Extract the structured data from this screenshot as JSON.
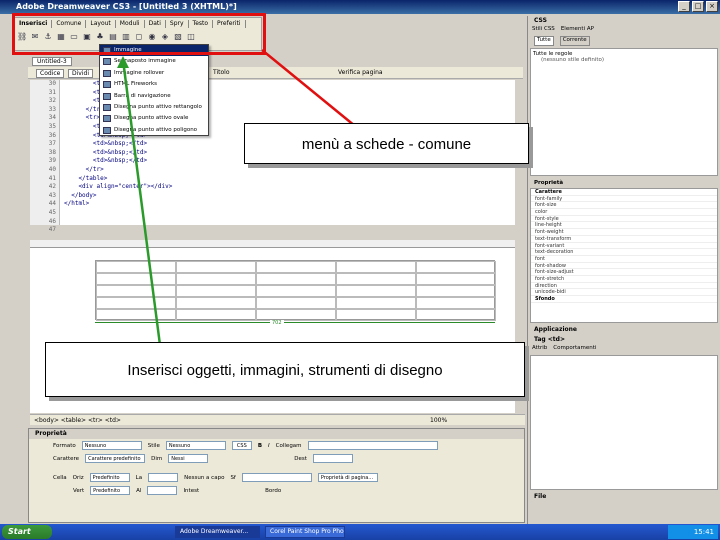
{
  "window": {
    "title": "Adobe Dreamweaver CS3 - [Untitled 3 (XHTML)*]"
  },
  "insert_bar": {
    "header": "Inserisci",
    "tabs": [
      "Comune",
      "Layout",
      "Moduli",
      "Dati",
      "Spry",
      "Testo",
      "Preferiti"
    ]
  },
  "dropdown": {
    "items": [
      "Immagine",
      "Segnaposto immagine",
      "Immagine rollover",
      "HTML Fireworks",
      "Barra di navigazione",
      "Disegna punto attivo rettangolo",
      "Disegna punto attivo ovale",
      "Disegna punto attivo poligono"
    ]
  },
  "document": {
    "file_tab": "Untitled-3",
    "view_buttons": [
      "Codice",
      "Dividi",
      "Progettazione"
    ],
    "title_field": "Titolo",
    "check_page": "Verifica pagina",
    "line_numbers": [
      "30",
      "31",
      "32",
      "33",
      "34",
      "35",
      "36",
      "37",
      "38",
      "39",
      "40",
      "41",
      "42",
      "43",
      "44",
      "45",
      "46",
      "47"
    ],
    "code_lines": [
      "        <td>&nbsp;</td>",
      "        <td>&nbsp;</td>",
      "        <td>&nbsp;</td>",
      "      </tr>",
      "      <tr>",
      "        <td>&nbsp;</td>",
      "        <td>&nbsp;</td>",
      "        <td>&nbsp;</td>",
      "        <td>&nbsp;</td>",
      "        <td>&nbsp;</td>",
      "      </tr>",
      "    </table>",
      "    <div align=\"center\"></div>",
      "  </body>",
      "</html>",
      "",
      "",
      ""
    ],
    "table_width_label": "702",
    "status_path": "<body> <table> <tr> <td>",
    "zoom": "100%"
  },
  "callouts": {
    "top": "menù a schede - comune",
    "bottom": "Inserisci oggetti, immagini, strumenti di disegno"
  },
  "right_panel": {
    "css_header": "CSS",
    "css_tabs": [
      "Stili CSS",
      "Elementi AP"
    ],
    "mode_buttons": [
      "Tutte",
      "Corrente"
    ],
    "all_rules": "Tutte le regole",
    "no_style": "(nessuno stile definito)",
    "props_header": "Proprietà",
    "prop_group": "Carattere",
    "prop_items": [
      "font-family",
      "font-size",
      "color",
      "font-style",
      "line-height",
      "font-weight",
      "text-transform",
      "font-variant",
      "text-decoration",
      "font",
      "font-shadow",
      "font-size-adjust",
      "font-stretch",
      "direction",
      "unicode-bidi"
    ],
    "bg_group": "Sfondo",
    "apps_header": "Applicazione",
    "tag_header": "Tag <td>",
    "tag_tabs": [
      "Attrib",
      "Comportamenti"
    ],
    "files_header": "File"
  },
  "properties": {
    "header": "Proprietà",
    "format_label": "Formato",
    "format_value": "Nessuno",
    "style_label": "Stile",
    "style_value": "Nessuno",
    "css_button": "CSS",
    "link_label": "Collegam",
    "font_label": "Carattere",
    "font_value": "Carattere predefinito",
    "size_label": "Dim",
    "size_value": "Nessi",
    "dest_label": "Dest",
    "cell_label": "Cella",
    "horz_label": "Oriz",
    "horz_value": "Predefinito",
    "vert_label": "Vert",
    "vert_value": "Predefinito",
    "w_label": "La",
    "h_label": "Al",
    "nowrap_label": "Nessun a capo",
    "header_label": "Intest",
    "bg_label": "Sf",
    "border_label": "Bordo",
    "page_props_button": "Proprietà di pagina..."
  },
  "taskbar": {
    "start": "Start",
    "items": [
      "Adobe Dreamweaver...",
      "Corel Paint Shop Pro Pho..."
    ],
    "clock": "15:41"
  },
  "colors": {
    "highlight_red": "#e01010",
    "arrow_red": "#e01010",
    "arrow_green": "#2a9a2a"
  }
}
